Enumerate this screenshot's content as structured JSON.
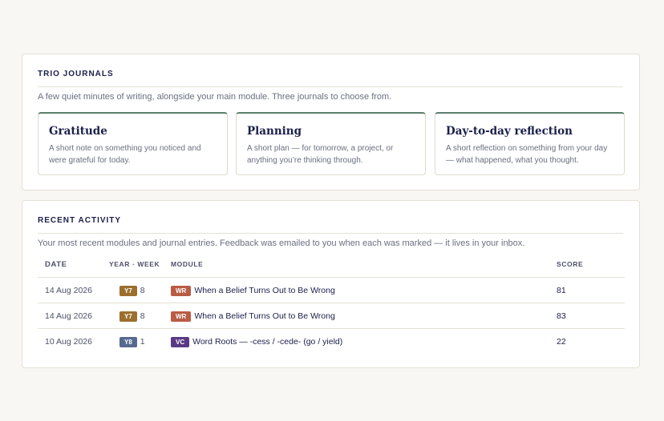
{
  "journals": {
    "title": "TRIO JOURNALS",
    "description": "A few quiet minutes of writing, alongside your main module. Three journals to choose from.",
    "items": [
      {
        "title": "Gratitude",
        "description": "A short note on something you noticed and were grateful for today."
      },
      {
        "title": "Planning",
        "description": "A short plan — for tomorrow, a project, or anything you’re thinking through."
      },
      {
        "title": "Day-to-day reflection",
        "description": "A short reflection on something from your day — what happened, what you thought."
      }
    ]
  },
  "activity": {
    "title": "RECENT ACTIVITY",
    "description": "Your most recent modules and journal entries. Feedback was emailed to you when each was marked — it lives in your inbox.",
    "columns": {
      "date": "DATE",
      "year_week": "YEAR · WEEK",
      "module": "MODULE",
      "score": "SCORE"
    },
    "rows": [
      {
        "date": "14 Aug 2026",
        "year": "Y7",
        "year_color": "#9a6f2e",
        "week": "8",
        "module_code": "WR",
        "module_color": "#b85c44",
        "module_title": "When a Belief Turns Out to Be Wrong",
        "score": "81"
      },
      {
        "date": "14 Aug 2026",
        "year": "Y7",
        "year_color": "#9a6f2e",
        "week": "8",
        "module_code": "WR",
        "module_color": "#b85c44",
        "module_title": "When a Belief Turns Out to Be Wrong",
        "score": "83"
      },
      {
        "date": "10 Aug 2026",
        "year": "Y8",
        "year_color": "#556a8e",
        "week": "1",
        "module_code": "VC",
        "module_color": "#5a3a86",
        "module_title": "Word Roots — -cess / -cede- (go / yield)",
        "score": "22"
      }
    ]
  },
  "colors": {
    "background": "#f8f7f3",
    "journal_accent": "#5b7e6b",
    "text_primary": "#1a1f4a",
    "text_muted": "#6b6f80"
  }
}
